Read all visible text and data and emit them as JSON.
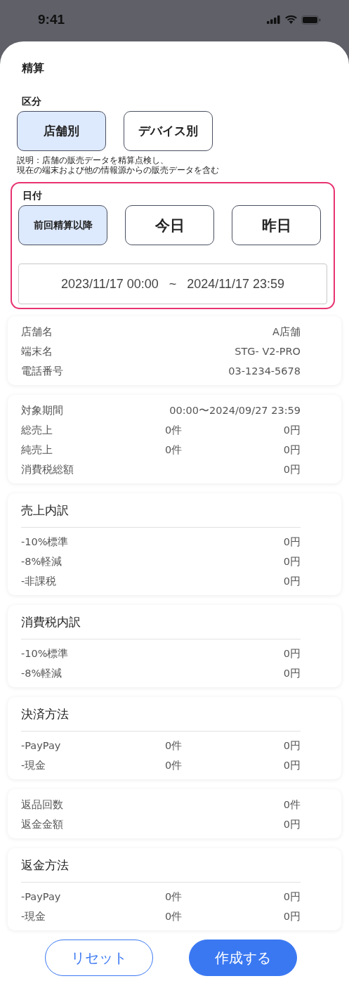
{
  "status_bar": {
    "time": "9:41"
  },
  "sheet": {
    "title": "精算"
  },
  "category": {
    "label": "区分",
    "options": [
      {
        "label": "店舗別",
        "selected": true
      },
      {
        "label": "デバイス別",
        "selected": false
      }
    ],
    "description": [
      "説明：店舗の販売データを精算点検し、",
      "現在の端末および他の情報源からの販売データを含む"
    ]
  },
  "date": {
    "label": "日付",
    "highlighted": true,
    "options": [
      {
        "label": "前回精算以降",
        "selected": true
      },
      {
        "label": "今日",
        "selected": false
      },
      {
        "label": "昨日",
        "selected": false
      }
    ],
    "range": "2023/11/17 00:00   ~   2024/11/17 23:59"
  },
  "cards": [
    {
      "rows": [
        {
          "label": "店舗名",
          "amount": "A店舗"
        },
        {
          "label": "端末名",
          "amount": "STG- V2-PRO"
        },
        {
          "label": "電話番号",
          "amount": "03-1234-5678"
        }
      ]
    },
    {
      "rows": [
        {
          "label": "対象期間",
          "amount": "00:00〜2024/09/27 23:59"
        },
        {
          "label": "総売上",
          "count": "0件",
          "amount": "0円"
        },
        {
          "label": "純売上",
          "count": "0件",
          "amount": "0円"
        },
        {
          "label": "消費税総額",
          "amount": "0円"
        }
      ]
    },
    {
      "title": "売上内訳",
      "rows": [
        {
          "label": "-10%標準",
          "amount": "0円"
        },
        {
          "label": "-8%軽減",
          "amount": "0円"
        },
        {
          "label": "-非課税",
          "amount": "0円"
        }
      ]
    },
    {
      "title": "消費税内訳",
      "rows": [
        {
          "label": "-10%標準",
          "amount": "0円"
        },
        {
          "label": "-8%軽減",
          "amount": "0円"
        }
      ]
    },
    {
      "title": "決済方法",
      "rows": [
        {
          "label": "-PayPay",
          "count": "0件",
          "amount": "0円"
        },
        {
          "label": "-現金",
          "count": "0件",
          "amount": "0円"
        }
      ]
    },
    {
      "rows": [
        {
          "label": "返品回数",
          "amount": "0件"
        },
        {
          "label": "返金金額",
          "amount": "0円"
        }
      ]
    },
    {
      "title": "返金方法",
      "rows": [
        {
          "label": "-PayPay",
          "count": "0件",
          "amount": "0円"
        },
        {
          "label": "-現金",
          "count": "0件",
          "amount": "0円"
        }
      ]
    }
  ],
  "buttons": [
    {
      "label": "リセット",
      "kind": "secondary"
    },
    {
      "label": "作成する",
      "kind": "primary"
    }
  ]
}
